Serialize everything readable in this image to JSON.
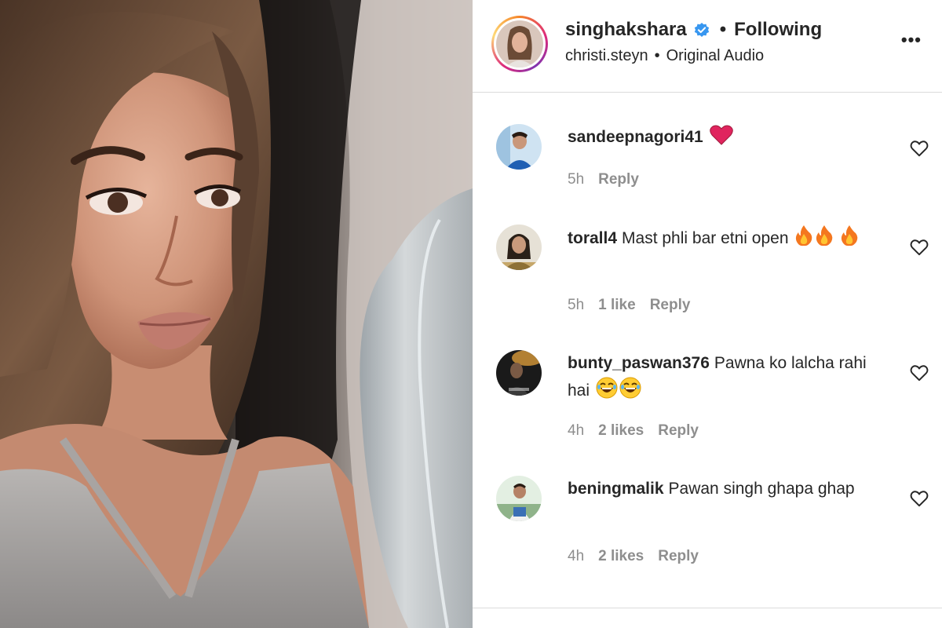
{
  "post": {
    "username": "singhakshara",
    "separator": "•",
    "follow_status": "Following",
    "audio_user": "christi.steyn",
    "audio_separator": "•",
    "audio_name": "Original Audio",
    "more_label": "•••"
  },
  "comments": [
    {
      "user": "sandeepnagori41",
      "text": "",
      "emoji": [
        "heart"
      ],
      "time": "5h",
      "likes": "",
      "reply": "Reply"
    },
    {
      "user": "torall4",
      "text": "Mast phli bar etni open",
      "emoji": [
        "fire",
        "fire",
        "fire"
      ],
      "time": "5h",
      "likes": "1 like",
      "reply": "Reply"
    },
    {
      "user": "bunty_paswan376",
      "text": "Pawna ko lalcha rahi hai",
      "emoji": [
        "laugh",
        "laugh"
      ],
      "time": "4h",
      "likes": "2 likes",
      "reply": "Reply"
    },
    {
      "user": "beningmalik",
      "text": "Pawan singh ghapa ghap",
      "emoji": [],
      "time": "4h",
      "likes": "2 likes",
      "reply": "Reply"
    }
  ],
  "colors": {
    "verified": "#3897f0",
    "text": "#262626",
    "muted": "#8e8e8e",
    "divider": "#dbdbdb",
    "heart_emoji": "#e0245e"
  },
  "icons": {
    "comment_like": "heart-outline-icon",
    "verified": "verified-badge-icon",
    "more": "more-options-icon"
  }
}
